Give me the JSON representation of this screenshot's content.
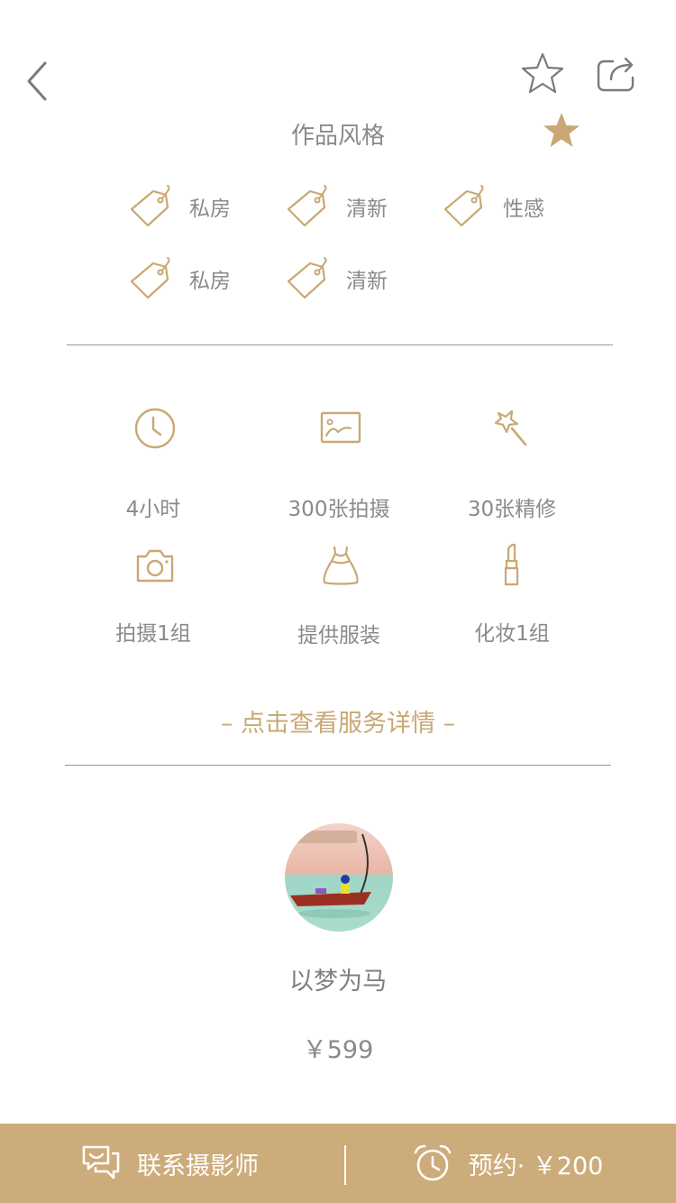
{
  "header": {
    "back_icon": "chevron-left-icon",
    "favorite_icon": "star-outline-icon",
    "share_icon": "share-icon"
  },
  "style_section": {
    "title": "作品风格",
    "star_icon": "star-filled-icon",
    "tags": [
      {
        "label": "私房",
        "icon": "tag-icon"
      },
      {
        "label": "清新",
        "icon": "tag-icon"
      },
      {
        "label": "性感",
        "icon": "tag-icon"
      },
      {
        "label": "私房",
        "icon": "tag-icon"
      },
      {
        "label": "清新",
        "icon": "tag-icon"
      }
    ]
  },
  "features": [
    {
      "label": "4小时",
      "icon": "clock-icon"
    },
    {
      "label": "300张拍摄",
      "icon": "image-icon"
    },
    {
      "label": "30张精修",
      "icon": "magic-wand-icon"
    },
    {
      "label": "拍摄1组",
      "icon": "camera-icon"
    },
    {
      "label": "提供服装",
      "icon": "dress-icon"
    },
    {
      "label": "化妆1组",
      "icon": "lipstick-icon"
    }
  ],
  "details_link": "– 点击查看服务详情 –",
  "photographer": {
    "nickname": "以梦为马",
    "price": "￥599"
  },
  "bottom_bar": {
    "contact_label": "联系摄影师",
    "contact_icon": "chat-icon",
    "book_label": "预约· ￥200",
    "book_icon": "alarm-clock-icon"
  },
  "colors": {
    "accent": "#c9a874",
    "bar": "#cdac7b",
    "text": "#8a8a8a"
  }
}
